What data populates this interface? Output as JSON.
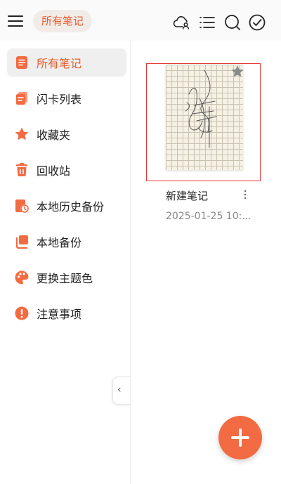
{
  "header": {
    "title": "所有笔记",
    "icons": [
      "cloud-user-icon",
      "list-icon",
      "search-icon",
      "check-circle-icon"
    ]
  },
  "sidebar": {
    "items": [
      {
        "label": "所有笔记",
        "icon": "notes-icon",
        "active": true
      },
      {
        "label": "闪卡列表",
        "icon": "flashcard-icon",
        "active": false
      },
      {
        "label": "收藏夹",
        "icon": "star-icon",
        "active": false
      },
      {
        "label": "回收站",
        "icon": "trash-icon",
        "active": false
      },
      {
        "label": "本地历史备份",
        "icon": "history-backup-icon",
        "active": false
      },
      {
        "label": "本地备份",
        "icon": "backup-icon",
        "active": false
      },
      {
        "label": "更换主题色",
        "icon": "palette-icon",
        "active": false
      },
      {
        "label": "注意事项",
        "icon": "alert-icon",
        "active": false
      }
    ]
  },
  "note": {
    "title": "新建笔记",
    "date": "2025-01-25 10:..."
  },
  "colors": {
    "accent": "#f26b42",
    "accent_text": "#e85d2c",
    "active_bg": "#efefef"
  }
}
